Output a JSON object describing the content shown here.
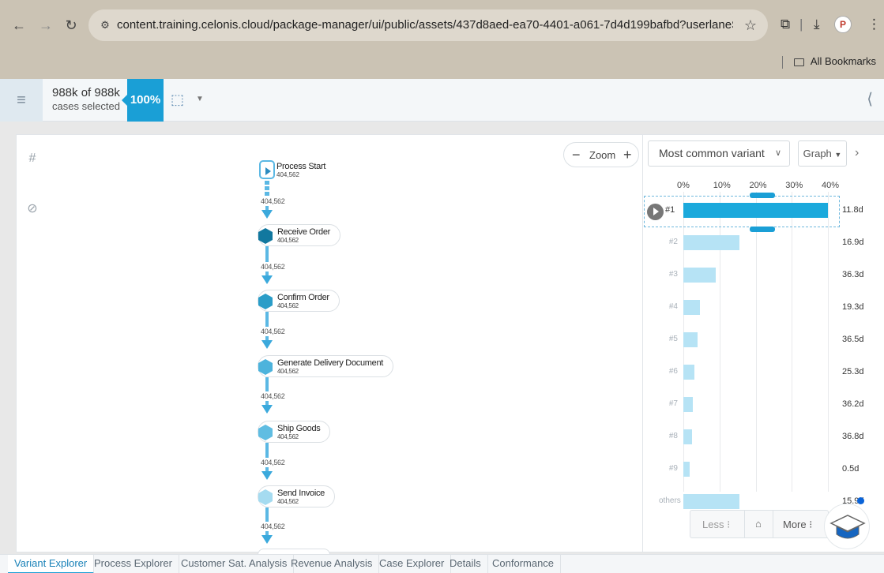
{
  "browser": {
    "url": "content.training.celonis.cloud/package-manager/ui/public/assets/437d8aed-ea70-4401-a061-7d4d199bafbd?userlaneStart=67295#!/documents...",
    "bookmarks_label": "All Bookmarks"
  },
  "header": {
    "cases_count": "988k of 988k",
    "cases_label": "cases selected",
    "percent": "100%"
  },
  "zoom": {
    "label": "Zoom"
  },
  "process": {
    "start": {
      "name": "Process Start",
      "count": "404,562"
    },
    "edges": [
      "404,562",
      "404,562",
      "404,562",
      "404,562",
      "404,562",
      "404,562"
    ],
    "activities": [
      {
        "name": "Receive Order",
        "count": "404,562",
        "color": "#12789f"
      },
      {
        "name": "Confirm Order",
        "count": "404,562",
        "color": "#2a9dc8"
      },
      {
        "name": "Generate Delivery Document",
        "count": "404,562",
        "color": "#4db3dc"
      },
      {
        "name": "Ship Goods",
        "count": "404,562",
        "color": "#60bde2"
      },
      {
        "name": "Send Invoice",
        "count": "404,562",
        "color": "#a5dbf0"
      }
    ]
  },
  "variants": {
    "selector": "Most common variant",
    "view_button": "Graph",
    "axis_ticks": [
      "0%",
      "10%",
      "20%",
      "30%",
      "40%"
    ],
    "rows": [
      {
        "label": "#1",
        "duration": "11.8d",
        "selected": true
      },
      {
        "label": "#2",
        "duration": "16.9d"
      },
      {
        "label": "#3",
        "duration": "36.3d"
      },
      {
        "label": "#4",
        "duration": "19.3d"
      },
      {
        "label": "#5",
        "duration": "36.5d"
      },
      {
        "label": "#6",
        "duration": "25.3d"
      },
      {
        "label": "#7",
        "duration": "36.2d"
      },
      {
        "label": "#8",
        "duration": "36.8d"
      },
      {
        "label": "#9",
        "duration": "0.5d"
      },
      {
        "label": "others",
        "duration": "15.9d"
      }
    ],
    "less_label": "Less",
    "more_label": "More"
  },
  "chart_data": {
    "type": "bar",
    "orientation": "horizontal",
    "categories": [
      "#1",
      "#2",
      "#3",
      "#4",
      "#5",
      "#6",
      "#7",
      "#8",
      "#9",
      "others"
    ],
    "values": [
      40,
      15.5,
      9,
      4.5,
      4,
      3,
      2.7,
      2.3,
      1.8,
      15.5
    ],
    "xlim": [
      0,
      45
    ],
    "x_ticks": [
      "0%",
      "10%",
      "20%",
      "30%",
      "40%"
    ],
    "grid": true,
    "colors": {
      "selected": "#1ba9dc",
      "default": "#b6e3f5"
    }
  },
  "tabs": [
    {
      "label": "Variant Explorer",
      "active": true
    },
    {
      "label": "Process Explorer"
    },
    {
      "label": "Customer Sat. Analysis"
    },
    {
      "label": "Revenue Analysis"
    },
    {
      "label": "Case Explorer"
    },
    {
      "label": "Details"
    },
    {
      "label": "Conformance"
    }
  ]
}
